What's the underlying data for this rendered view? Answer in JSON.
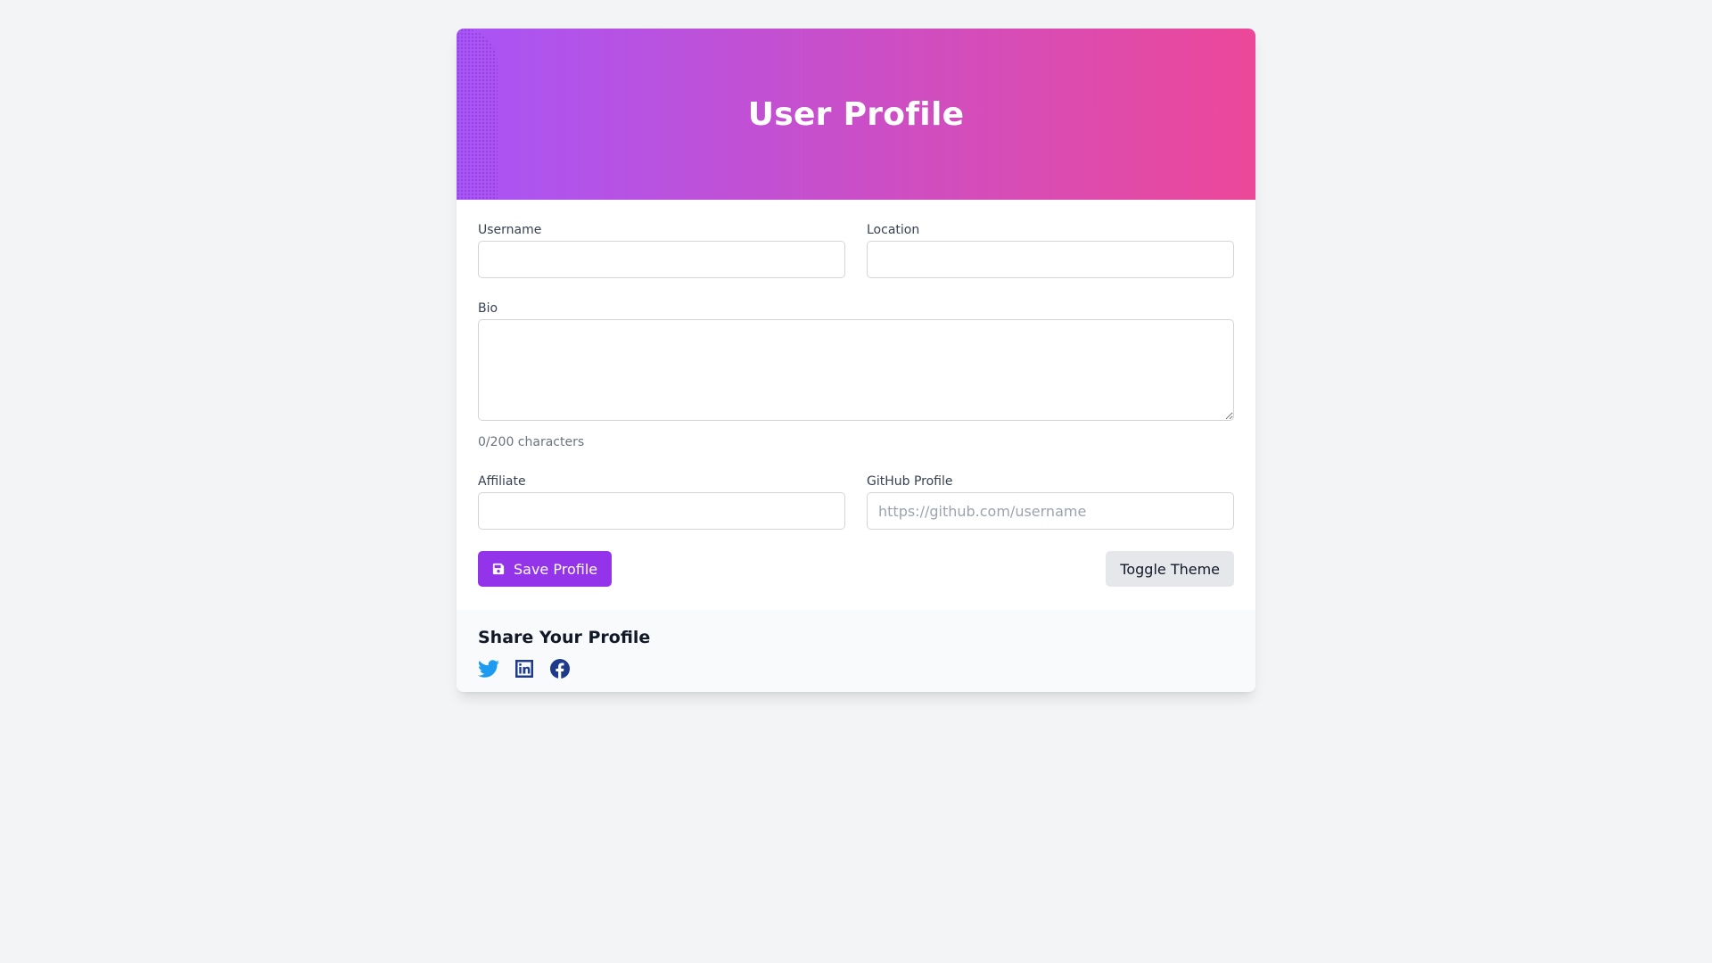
{
  "header": {
    "title": "User Profile",
    "gradient_start": "#a855f7",
    "gradient_end": "#ec4899"
  },
  "form": {
    "username": {
      "label": "Username",
      "value": "",
      "placeholder": ""
    },
    "location": {
      "label": "Location",
      "value": "",
      "placeholder": ""
    },
    "bio": {
      "label": "Bio",
      "value": "",
      "placeholder": "",
      "counter": "0/200 characters"
    },
    "affiliate": {
      "label": "Affiliate",
      "value": "",
      "placeholder": ""
    },
    "github": {
      "label": "GitHub Profile",
      "value": "",
      "placeholder": "https://github.com/username"
    }
  },
  "actions": {
    "save_label": "Save Profile",
    "save_icon": "floppy-disk-icon",
    "save_color": "#9333ea",
    "toggle_label": "Toggle Theme",
    "toggle_color": "#e5e7eb"
  },
  "share": {
    "title": "Share Your Profile",
    "links": [
      {
        "icon": "twitter-icon",
        "color": "#1d9bf0"
      },
      {
        "icon": "linkedin-icon",
        "color": "#1e3a8a"
      },
      {
        "icon": "facebook-icon",
        "color": "#1e3a8a"
      }
    ]
  }
}
